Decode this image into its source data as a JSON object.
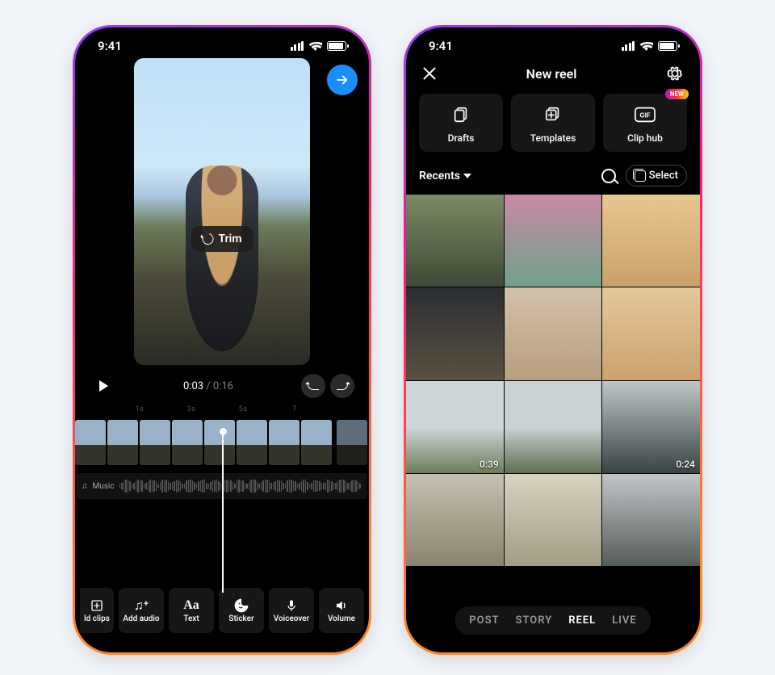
{
  "status": {
    "time": "9:41"
  },
  "phone1": {
    "trim_label": "Trim",
    "time_current": "0:03",
    "time_total": "0:16",
    "timeline_ticks": [
      "1s",
      "3s",
      "5s",
      "7"
    ],
    "music_label": "Music",
    "tools": {
      "add_clips": "ld clips",
      "add_audio": "Add audio",
      "text": "Text",
      "sticker": "Sticker",
      "voiceover": "Voiceover",
      "volume": "Volume"
    }
  },
  "phone2": {
    "title": "New reel",
    "options": {
      "drafts": "Drafts",
      "templates": "Templates",
      "clip_hub": "Clip hub",
      "new_badge": "NEW"
    },
    "recents_label": "Recents",
    "select_label": "Select",
    "durations": {
      "cell5": "0:39",
      "cell6": "0:24"
    },
    "modes": {
      "post": "POST",
      "story": "STORY",
      "reel": "REEL",
      "live": "LIVE"
    }
  },
  "colors": {
    "accent_blue": "#1a8dff",
    "gradient_start": "#913AFF",
    "gradient_mid": "#FF1778",
    "gradient_end": "#FF8820"
  }
}
